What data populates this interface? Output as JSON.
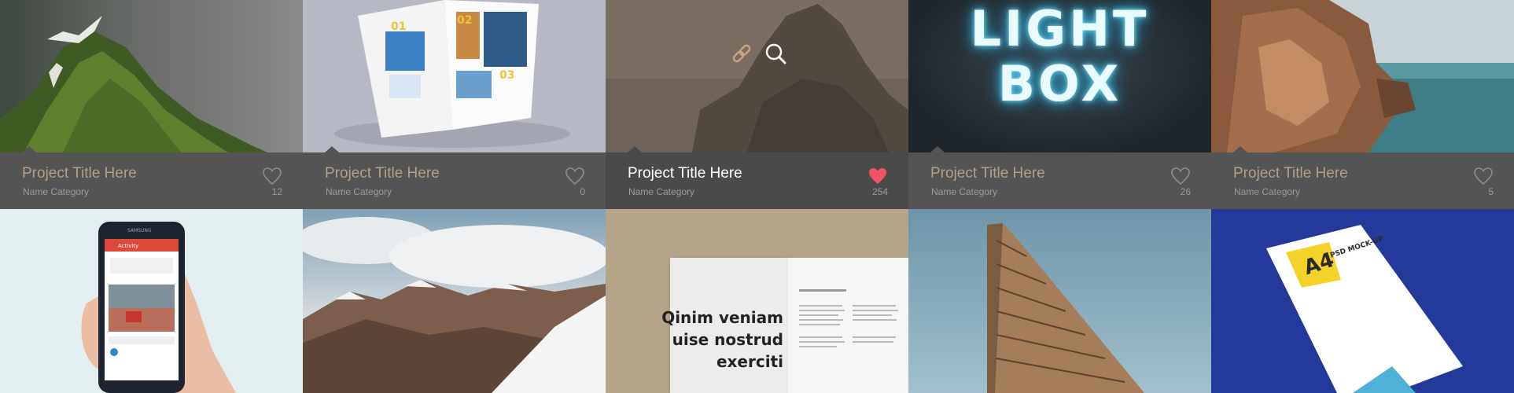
{
  "projects": [
    {
      "title": "Project Title Here",
      "category": "Name Category",
      "likes": "12",
      "active": false
    },
    {
      "title": "Project Title Here",
      "category": "Name Category",
      "likes": "0",
      "active": false
    },
    {
      "title": "Project Title Here",
      "category": "Name Category",
      "likes": "254",
      "active": true
    },
    {
      "title": "Project Title Here",
      "category": "Name Category",
      "likes": "26",
      "active": false
    },
    {
      "title": "Project Title Here",
      "category": "Name Category",
      "likes": "5",
      "active": false
    }
  ],
  "thumbnails": {
    "lightbox_line1": "LIGHT",
    "lightbox_line2": "BOX",
    "magazine_headline": [
      "Qinim veniam",
      "uise nostrud",
      "exerciti"
    ],
    "mockup_label": "A4",
    "mockup_sub": "PSD MOCK-UP",
    "phone_brand": "SAMSUNG",
    "phone_app_title": "Activity",
    "brochure_numbers": [
      "01",
      "02",
      "03"
    ]
  },
  "colors": {
    "caption_bg": "#545454",
    "caption_active_bg": "#4a4a4a",
    "title_color": "#b59f86",
    "heart_active": "#ef5466",
    "heart_outline": "#8c8c8c"
  }
}
